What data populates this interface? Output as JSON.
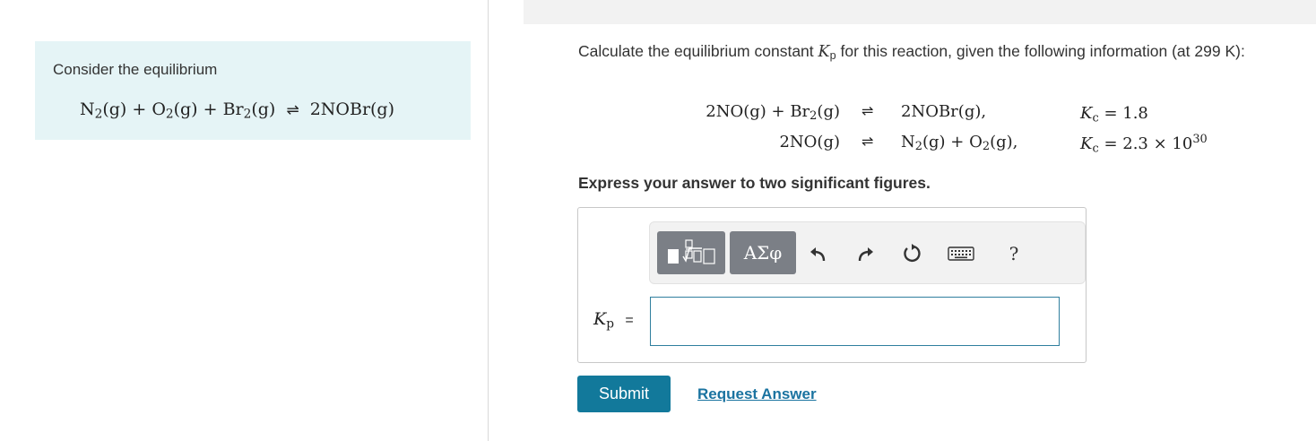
{
  "intro": {
    "text": "Consider the equilibrium",
    "eq_part1": "N",
    "eq_part2": "2",
    "eq_part3": "(g) + O",
    "eq_part4": "2",
    "eq_part5": "(g) + Br",
    "eq_part6": "2",
    "eq_part7": "(g)",
    "eq_arrow": "⇌",
    "eq_product": "2NOBr(g)"
  },
  "question": {
    "pre": "Calculate the equilibrium constant ",
    "k_symbol": "K",
    "k_sub": "p",
    "post": " for this reaction, given the following information (at 299 K):"
  },
  "reactions": [
    {
      "left": "2NO(g) + Br",
      "left_sub": "2",
      "left_tail": "(g)",
      "arrow": "⇌",
      "right": "2NOBr(g),",
      "k_symbol": "K",
      "k_sub": "c",
      "k_value": " = 1.8",
      "k_exp": ""
    },
    {
      "left": "2NO(g)",
      "left_sub": "",
      "left_tail": "",
      "arrow": "⇌",
      "right_a": "N",
      "right_b": "2",
      "right_c": "(g) + O",
      "right_d": "2",
      "right_e": "(g),",
      "k_symbol": "K",
      "k_sub": "c",
      "k_value": " = 2.3 × 10",
      "k_exp": "30"
    }
  ],
  "instruction": "Express your answer to two significant figures.",
  "toolbar": {
    "templates_icon": "templates-icon",
    "symbols_label": "ΑΣφ",
    "undo_icon": "undo-icon",
    "redo_icon": "redo-icon",
    "reset_icon": "reset-icon",
    "keyboard_icon": "keyboard-icon",
    "help_label": "?"
  },
  "answer": {
    "label_symbol": "K",
    "label_sub": "p",
    "label_eq": " =",
    "value": ""
  },
  "actions": {
    "submit": "Submit",
    "request": "Request Answer"
  },
  "colors": {
    "intro_bg": "#e5f4f6",
    "submit_bg": "#12799b",
    "link": "#1a73a0",
    "input_border": "#2f7f9e"
  }
}
